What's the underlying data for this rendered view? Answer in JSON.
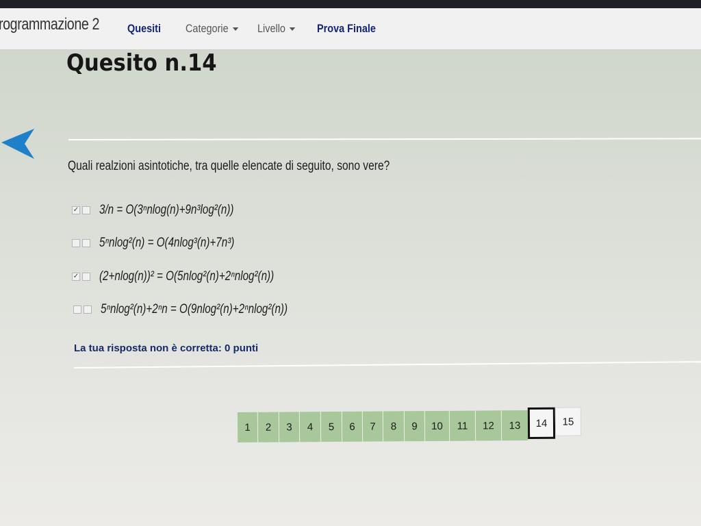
{
  "navbar": {
    "brand": "rogrammazione 2",
    "items": [
      {
        "label": "Quesiti",
        "dropdown": false
      },
      {
        "label": "Categorie",
        "dropdown": true
      },
      {
        "label": "Livello",
        "dropdown": true
      },
      {
        "label": "Prova Finale",
        "dropdown": false
      }
    ]
  },
  "question": {
    "title": "Quesito n.14",
    "text": "Quali realzioni asintotiche, tra quelle elencate di seguito, sono vere?",
    "options": [
      {
        "expression": "3/n = O(3ⁿnlog(n)+9n³log²(n))",
        "correct_mark": true,
        "selected": false
      },
      {
        "expression": "5ⁿnlog²(n) = O(4nlog³(n)+7n³)",
        "correct_mark": false,
        "selected": false
      },
      {
        "expression": "(2+nlog(n))² = O(5nlog²(n)+2ⁿnlog²(n))",
        "correct_mark": true,
        "selected": false
      },
      {
        "expression": "5ⁿnlog²(n)+2ⁿn = O(9nlog²(n)+2ⁿnlog²(n))",
        "correct_mark": false,
        "selected": false
      }
    ],
    "result": "La tua risposta non è corretta: 0 punti"
  },
  "pagination": {
    "pages": [
      "1",
      "2",
      "3",
      "4",
      "5",
      "6",
      "7",
      "8",
      "9",
      "10",
      "11",
      "12",
      "13",
      "14",
      "15"
    ],
    "current": "14"
  },
  "colors": {
    "accent": "#12257a",
    "answered": "#a8c79a",
    "back_arrow": "#1f7fc8"
  },
  "icons": {
    "back": "back-arrow-icon",
    "check": "✓"
  }
}
